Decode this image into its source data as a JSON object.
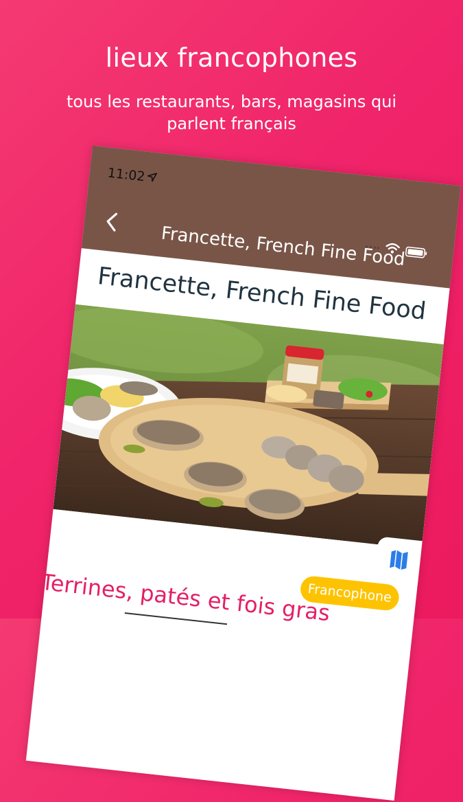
{
  "promo": {
    "title": "lieux francophones",
    "subtitle": "tous les restaurants, bars, magasins qui parlent français"
  },
  "status_bar": {
    "time": "11:02",
    "icons": [
      "location-arrow-icon",
      "signal-icon",
      "wifi-icon",
      "battery-icon"
    ]
  },
  "app_bar": {
    "title": "Francette, French Fine Food",
    "back_icon": "chevron-left-icon",
    "color": "#795548"
  },
  "detail": {
    "title": "Francette, French Fine Food",
    "photo_alt": "Terrines, pâtés and bread on a wooden board outdoors",
    "badge": "Francophone",
    "section_heading": "Terrines, patés et fois gras"
  },
  "colors": {
    "background": "#f0246a",
    "badge": "#fdc300",
    "heading_accent": "#e41f65",
    "map_icon": "#2b7de9"
  }
}
